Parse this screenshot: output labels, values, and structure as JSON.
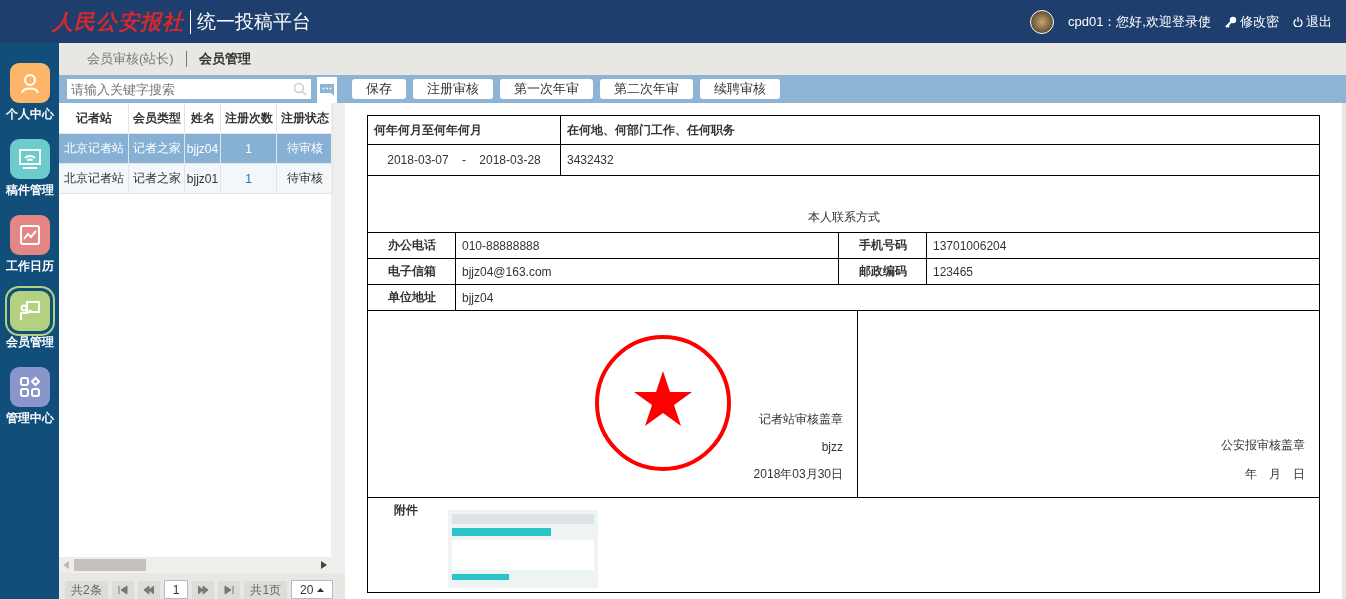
{
  "header": {
    "brand": "人民公安报社",
    "platform": "统一投稿平台",
    "greeting": "cpd01：您好,欢迎登录使",
    "change_password": "修改密",
    "logout": "退出"
  },
  "sidebar": {
    "items": [
      {
        "label": "个人中心",
        "kind": "person",
        "color": "#fdb56a",
        "selected": false
      },
      {
        "label": "稿件管理",
        "kind": "monitor",
        "color": "#6ccbcb",
        "selected": false
      },
      {
        "label": "工作日历",
        "kind": "chart",
        "color": "#e48586",
        "selected": false
      },
      {
        "label": "会员管理",
        "kind": "presenter",
        "color": "#b3d180",
        "selected": true
      },
      {
        "label": "管理中心",
        "kind": "grid",
        "color": "#8a95cc",
        "selected": false
      }
    ]
  },
  "tabs": [
    {
      "label": "会员审核(站长)",
      "selected": false
    },
    {
      "label": "会员管理",
      "selected": true
    }
  ],
  "search": {
    "placeholder": "请输入关键字搜索"
  },
  "toolbar": [
    "保存",
    "注册审核",
    "第一次年审",
    "第二次年审",
    "续聘审核"
  ],
  "table": {
    "columns": [
      "记者站",
      "会员类型",
      "姓名",
      "注册次数",
      "注册状态"
    ],
    "rows": [
      {
        "cells": [
          "北京记者站",
          "记者之家",
          "bjjz04",
          "1",
          "待审核"
        ],
        "selected": true
      },
      {
        "cells": [
          "北京记者站",
          "记者之家",
          "bjjz01",
          "1",
          "待审核"
        ],
        "selected": false
      }
    ]
  },
  "pager": {
    "total": "共2条",
    "page": "1",
    "pages": "共1页",
    "page_size": "20"
  },
  "form": {
    "work_header": [
      "何年何月至何年何月",
      "在何地、何部门工作、任何职务"
    ],
    "work_rows": [
      {
        "from": "2018-03-07",
        "sep": "-",
        "to": "2018-03-28",
        "desc": "3432432"
      }
    ],
    "contact_title": "本人联系方式",
    "contact": [
      {
        "label": "办公电话",
        "value": "010-88888888"
      },
      {
        "label": "手机号码",
        "value": "13701006204"
      },
      {
        "label": "电子信箱",
        "value": "bjjz04@163.com"
      },
      {
        "label": "邮政编码",
        "value": "123465"
      },
      {
        "label": "单位地址",
        "value": "bjjz04"
      }
    ],
    "station_seal": {
      "title": "记者站审核盖章",
      "signer": "bjzz",
      "date": "2018年03月30日",
      "stamped": true
    },
    "police_seal": {
      "title": "公安报审核盖章",
      "date": "年　月　日"
    },
    "attachment_label": "附件"
  }
}
